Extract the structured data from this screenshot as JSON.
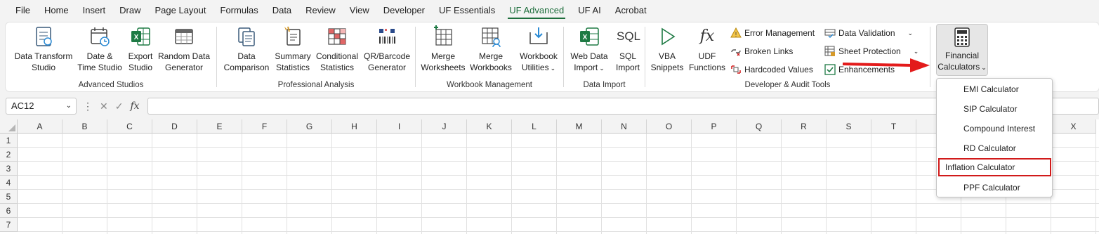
{
  "menu": {
    "tabs": [
      "File",
      "Home",
      "Insert",
      "Draw",
      "Page Layout",
      "Formulas",
      "Data",
      "Review",
      "View",
      "Developer",
      "UF Essentials",
      "UF Advanced",
      "UF AI",
      "Acrobat"
    ],
    "active": "UF Advanced"
  },
  "ribbon": {
    "groups": {
      "advanced_studios": "Advanced Studios",
      "professional_analysis": "Professional Analysis",
      "workbook_management": "Workbook Management",
      "data_import": "Data Import",
      "developer_audit": "Developer & Audit Tools"
    },
    "buttons": {
      "data_transform_1": "Data Transform",
      "data_transform_2": "Studio",
      "date_time_1": "Date &",
      "date_time_2": "Time Studio",
      "export_1": "Export",
      "export_2": "Studio",
      "random_1": "Random Data",
      "random_2": "Generator",
      "data_comparison_1": "Data",
      "data_comparison_2": "Comparison",
      "summary_1": "Summary",
      "summary_2": "Statistics",
      "conditional_1": "Conditional",
      "conditional_2": "Statistics",
      "qr_1": "QR/Barcode",
      "qr_2": "Generator",
      "merge_ws_1": "Merge",
      "merge_ws_2": "Worksheets",
      "merge_wb_1": "Merge",
      "merge_wb_2": "Workbooks",
      "wb_util_1": "Workbook",
      "wb_util_2": "Utilities",
      "web_data_1": "Web Data",
      "web_data_2": "Import",
      "sql_1": "SQL",
      "sql_2": "Import",
      "vba_1": "VBA",
      "vba_2": "Snippets",
      "udf_1": "UDF",
      "udf_2": "Functions",
      "error_mgmt": "Error Management",
      "broken_links": "Broken Links",
      "hardcoded": "Hardcoded Values",
      "data_validation": "Data Validation",
      "sheet_protection": "Sheet Protection",
      "enhancements": "Enhancements",
      "financial_1": "Financial",
      "financial_2": "Calculators"
    },
    "icon_text": {
      "sql": "SQL",
      "fx": "fx"
    }
  },
  "formula_bar": {
    "name_box": "AC12",
    "formula": "",
    "fx_label": "fx"
  },
  "sheet": {
    "columns": [
      "A",
      "B",
      "C",
      "D",
      "E",
      "F",
      "G",
      "H",
      "I",
      "J",
      "K",
      "L",
      "M",
      "N",
      "O",
      "P",
      "Q",
      "R",
      "S",
      "T",
      "",
      "",
      "",
      "X"
    ],
    "rows": [
      "1",
      "2",
      "3",
      "4",
      "5",
      "6",
      "7"
    ]
  },
  "dropdown": {
    "items": [
      "EMI Calculator",
      "SIP Calculator",
      "Compound Interest",
      "RD Calculator",
      "Inflation Calculator",
      "PPF Calculator"
    ],
    "highlighted": "Inflation Calculator"
  },
  "colors": {
    "accent": "#1e6e3c",
    "highlight_border": "#d11a1a",
    "arrow": "#e31b1b"
  }
}
